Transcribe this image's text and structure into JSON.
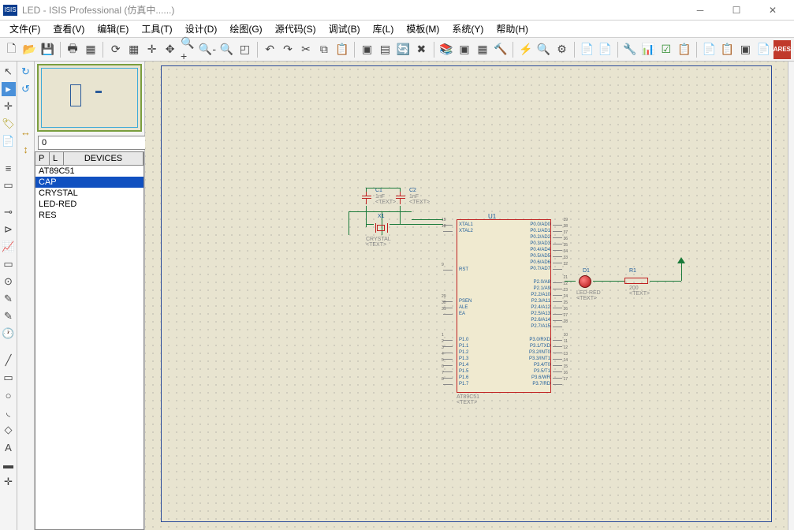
{
  "title": "LED - ISIS Professional (仿真中......)",
  "app_icon": "ISIS",
  "menu": [
    "文件(F)",
    "查看(V)",
    "编辑(E)",
    "工具(T)",
    "设计(D)",
    "绘图(G)",
    "源代码(S)",
    "调试(B)",
    "库(L)",
    "模板(M)",
    "系统(Y)",
    "帮助(H)"
  ],
  "nav_value": "0",
  "dev_headers": [
    "P",
    "L",
    "DEVICES"
  ],
  "devices": [
    "AT89C51",
    "CAP",
    "CRYSTAL",
    "LED-RED",
    "RES"
  ],
  "selected_device_index": 1,
  "components": {
    "c1": {
      "ref": "C1",
      "val": "1nF",
      "tag": "<TEXT>"
    },
    "c2": {
      "ref": "C2",
      "val": "1nF",
      "tag": "<TEXT>"
    },
    "x1": {
      "ref": "X1",
      "val": "CRYSTAL",
      "tag": "<TEXT>"
    },
    "u1": {
      "ref": "U1",
      "val": "AT89C51",
      "tag": "<TEXT>"
    },
    "d1": {
      "ref": "D1",
      "val": "LED-RED",
      "tag": "<TEXT>"
    },
    "r1": {
      "ref": "R1",
      "val": "200",
      "tag": "<TEXT>"
    }
  },
  "chip_pins": {
    "left_upper": [
      {
        "no": "19",
        "name": "XTAL1"
      },
      {
        "no": "18",
        "name": "XTAL2"
      }
    ],
    "left_mid": [
      {
        "no": "9",
        "name": "RST"
      }
    ],
    "left_lower": [
      {
        "no": "29",
        "name": "PSEN"
      },
      {
        "no": "30",
        "name": "ALE"
      },
      {
        "no": "31",
        "name": "EA"
      }
    ],
    "left_p1": [
      {
        "no": "1",
        "name": "P1.0"
      },
      {
        "no": "2",
        "name": "P1.1"
      },
      {
        "no": "3",
        "name": "P1.2"
      },
      {
        "no": "4",
        "name": "P1.3"
      },
      {
        "no": "5",
        "name": "P1.4"
      },
      {
        "no": "6",
        "name": "P1.5"
      },
      {
        "no": "7",
        "name": "P1.6"
      },
      {
        "no": "8",
        "name": "P1.7"
      }
    ],
    "right_p0": [
      {
        "no": "39",
        "name": "P0.0/AD0"
      },
      {
        "no": "38",
        "name": "P0.1/AD1"
      },
      {
        "no": "37",
        "name": "P0.2/AD2"
      },
      {
        "no": "36",
        "name": "P0.3/AD3"
      },
      {
        "no": "35",
        "name": "P0.4/AD4"
      },
      {
        "no": "34",
        "name": "P0.5/AD5"
      },
      {
        "no": "33",
        "name": "P0.6/AD6"
      },
      {
        "no": "32",
        "name": "P0.7/AD7"
      }
    ],
    "right_p2": [
      {
        "no": "21",
        "name": "P2.0/A8"
      },
      {
        "no": "22",
        "name": "P2.1/A9"
      },
      {
        "no": "23",
        "name": "P2.2/A10"
      },
      {
        "no": "24",
        "name": "P2.3/A11"
      },
      {
        "no": "25",
        "name": "P2.4/A12"
      },
      {
        "no": "26",
        "name": "P2.5/A13"
      },
      {
        "no": "27",
        "name": "P2.6/A14"
      },
      {
        "no": "28",
        "name": "P2.7/A15"
      }
    ],
    "right_p3": [
      {
        "no": "10",
        "name": "P3.0/RXD"
      },
      {
        "no": "11",
        "name": "P3.1/TXD"
      },
      {
        "no": "12",
        "name": "P3.2/INT0"
      },
      {
        "no": "13",
        "name": "P3.3/INT1"
      },
      {
        "no": "14",
        "name": "P3.4/T0"
      },
      {
        "no": "15",
        "name": "P3.5/T1"
      },
      {
        "no": "16",
        "name": "P3.6/WR"
      },
      {
        "no": "17",
        "name": "P3.7/RD"
      }
    ]
  },
  "ares": "ARES"
}
